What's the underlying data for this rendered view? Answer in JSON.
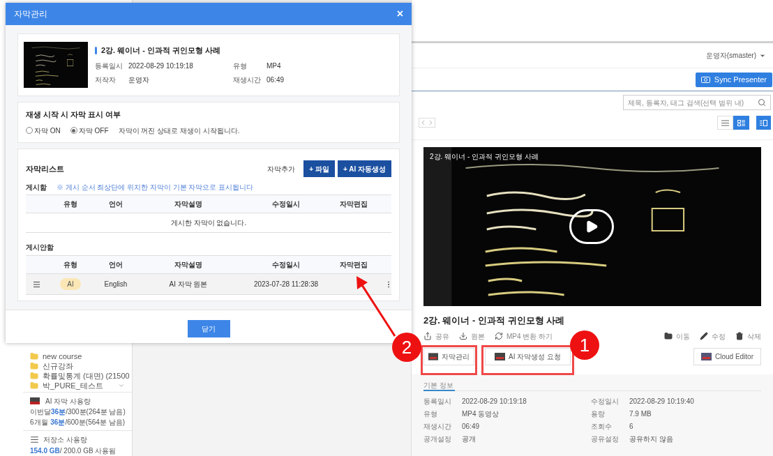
{
  "modal": {
    "title": "자막관리",
    "close": "×",
    "video": {
      "title": "2강. 웨이너 - 인과적 귀인모형 사례",
      "fields": [
        {
          "label": "등록일시",
          "value": "2022-08-29 10:19:18"
        },
        {
          "label": "유형",
          "value": "MP4"
        },
        {
          "label": "저작자",
          "value": "운영자"
        },
        {
          "label": "재생시간",
          "value": "06:49"
        }
      ]
    },
    "playback": {
      "heading": "재생 시작 시 자막 표시 여부",
      "options": [
        {
          "label": "자막 ON",
          "selected": false
        },
        {
          "label": "자막 OFF",
          "selected": true
        }
      ],
      "note": "자막이 꺼진 상태로 재생이 시작됩니다."
    },
    "subtitle_list": {
      "heading": "자막리스트",
      "add_label": "자막추가",
      "add_buttons": [
        "+ 파일",
        "+ AI 자동생성"
      ],
      "published": {
        "heading": "게시함",
        "notice": "※ 게시 순서 최상단에 위치한 자막이 기본 자막으로 표시됩니다",
        "columns": [
          "유형",
          "언어",
          "자막설명",
          "수정일시",
          "자막편집"
        ],
        "empty": "게시한 자막이 없습니다."
      },
      "unpublished": {
        "heading": "게시안함",
        "columns": [
          "유형",
          "언어",
          "자막설명",
          "수정일시",
          "자막편집"
        ],
        "rows": [
          {
            "type": "AI",
            "language": "English",
            "description": "AI 자막 원본",
            "modified": "2023-07-28 11:28:38"
          }
        ]
      }
    },
    "close_button": "닫기"
  },
  "page": {
    "user": "운영자(smaster)",
    "sync_button": "Sync Presenter",
    "search": {
      "placeholder": "제목, 등록자, 태그 검색(선택 범위 내)"
    },
    "view_modes": [
      {
        "selected": false
      },
      {
        "selected": true
      }
    ],
    "video": {
      "overlay_title": "2강. 웨이너 - 인과적 귀인모형 사례"
    },
    "title": "2강. 웨이너 - 인과적 귀인모형 사례",
    "actions_left": [
      "공유",
      "원본",
      "MP4 변환 하기"
    ],
    "actions_right": [
      "이동",
      "수정",
      "삭제"
    ],
    "tool_buttons": [
      "자막관리",
      "AI 자막생성 요청",
      "Cloud Editor"
    ],
    "info_tab": "기본 정보",
    "info": [
      {
        "label": "등록일시",
        "value": "2022-08-29 10:19:18"
      },
      {
        "label": "수정일시",
        "value": "2022-08-29 10:19:40"
      },
      {
        "label": "유형",
        "value": "MP4 동영상"
      },
      {
        "label": "용량",
        "value": "7.9 MB"
      },
      {
        "label": "재생시간",
        "value": "06:49"
      },
      {
        "label": "조회수",
        "value": "6"
      },
      {
        "label": "공개설정",
        "value": "공개"
      },
      {
        "label": "공유설정",
        "value": "공유하지 않음"
      }
    ],
    "sidebar": {
      "folders": [
        "new course",
        "신규강좌",
        "확률및통계 (대면) (21500",
        "박_PURE_테스트"
      ],
      "ai_usage": {
        "heading": "AI 자막 사용량",
        "rows": [
          {
            "label": "이번달",
            "used": "36분",
            "rest": "/300분(264분 남음)"
          },
          {
            "label": "6개월",
            "used": "36분",
            "rest": "/600분(564분 남음)"
          }
        ]
      },
      "storage": {
        "heading": "저장소 사용량",
        "used": "154.0 GB",
        "rest": " / 200.0 GB 사용됨"
      }
    }
  },
  "annotations": [
    {
      "number": "2"
    },
    {
      "number": "1"
    }
  ]
}
